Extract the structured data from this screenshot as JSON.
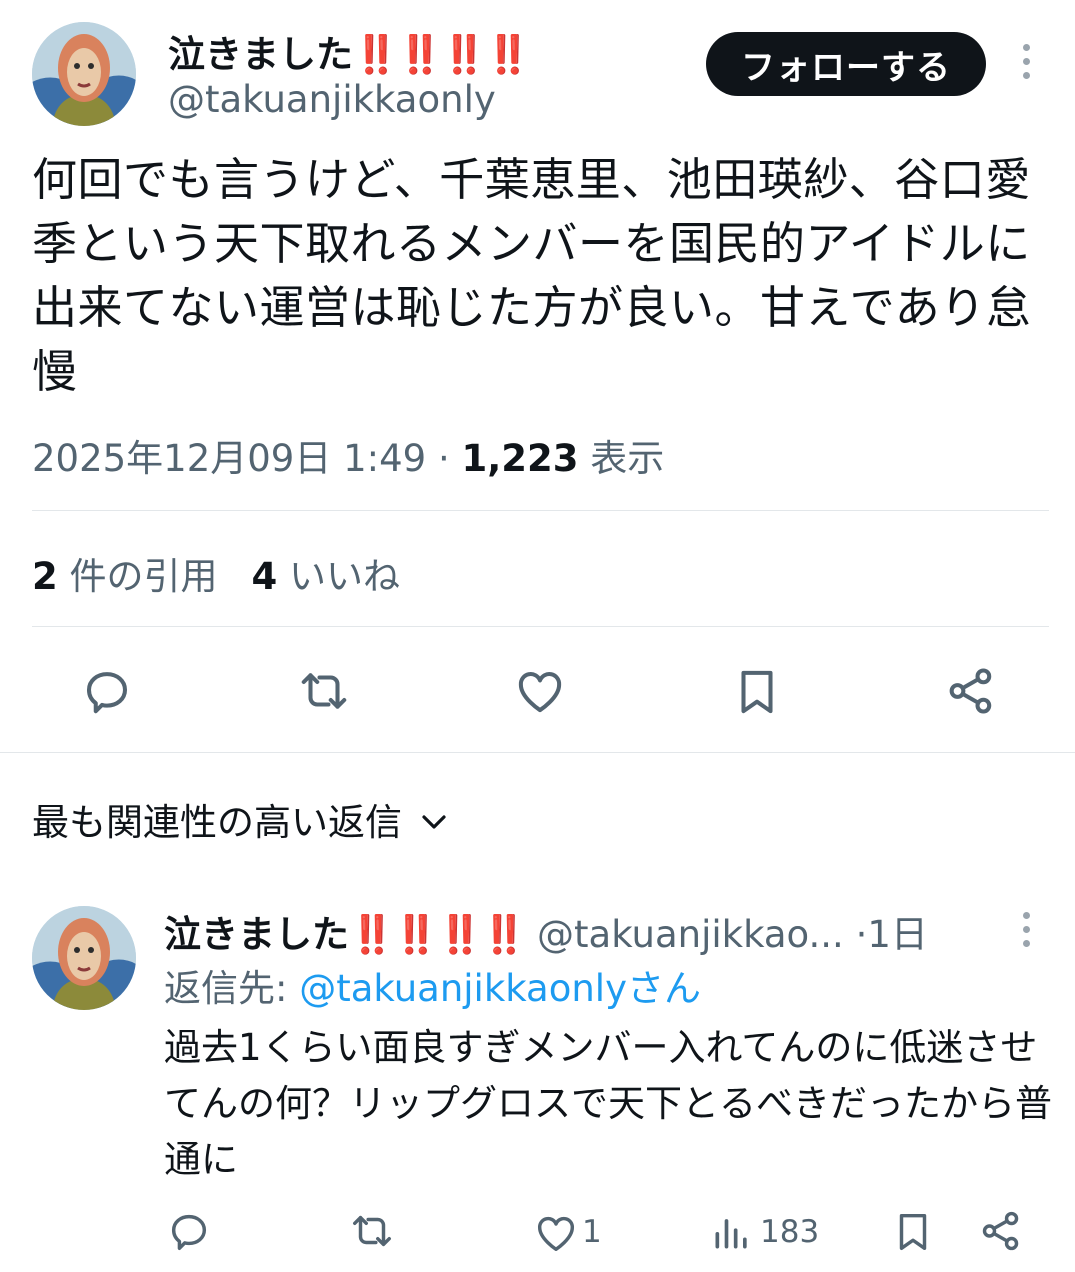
{
  "tweet": {
    "author_name": "泣きました",
    "author_bangs": "‼️‼️‼️‼️",
    "author_handle": "@takuanjikkaonly",
    "follow_label": "フォローする",
    "text": "何回でも言うけど、千葉恵里、池田瑛紗、谷口愛季という天下取れるメンバーを国民的アイドルに出来てない運営は恥じた方が良い。甘えであり怠慢",
    "timestamp": "2025年12月09日 1:49",
    "separator": "·",
    "views_count": "1,223",
    "views_label": "表示",
    "quotes_count": "2",
    "quotes_label": "件の引用",
    "likes_count": "4",
    "likes_label": "いいね"
  },
  "replies_sort": {
    "label": "最も関連性の高い返信"
  },
  "reply": {
    "author_name": "泣きました",
    "author_bangs": "‼️‼️‼️‼️",
    "author_handle": "@takuanjikkao...",
    "time": "·1日",
    "reply_to_label": "返信先: ",
    "reply_to_handle": "@takuanjikkaonlyさん",
    "text": "過去1くらい面良すぎメンバー入れてんのに低迷させてんの何？リップグロスで天下とるべきだったから普通に",
    "like_count": "1",
    "view_count": "183"
  },
  "icons": [
    "more-icon",
    "reply-icon",
    "retweet-icon",
    "like-icon",
    "bookmark-icon",
    "share-icon",
    "chevron-down-icon",
    "views-icon"
  ],
  "colors": {
    "text": "#0f1419",
    "muted": "#536471",
    "link": "#1d9bf0",
    "follow_bg": "#0f1419",
    "bangs": "#e0241b"
  }
}
